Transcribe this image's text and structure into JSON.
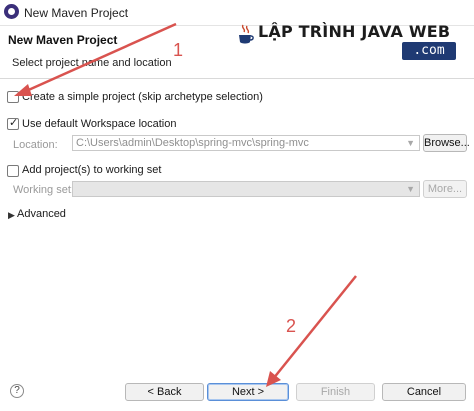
{
  "window": {
    "title": "New Maven Project"
  },
  "header": {
    "title": "New Maven Project",
    "subtitle": "Select project name and location"
  },
  "watermark": {
    "text": "LẬP TRÌNH JAVA WEB",
    "suffix": ".com"
  },
  "annotations": {
    "step1": "1",
    "step2": "2"
  },
  "options": {
    "simple_project": {
      "label": "Create a simple project (skip archetype selection)",
      "checked": false
    },
    "default_workspace": {
      "label": "Use default Workspace location",
      "checked": true
    },
    "location": {
      "label": "Location:",
      "value": "C:\\Users\\admin\\Desktop\\spring-mvc\\spring-mvc",
      "browse": "Browse..."
    },
    "working_set_check": {
      "label": "Add project(s) to working set",
      "checked": false
    },
    "working_set": {
      "label": "Working set:",
      "value": "",
      "more": "More..."
    },
    "advanced": {
      "label": "Advanced"
    }
  },
  "buttons": {
    "help": "?",
    "back": "< Back",
    "next": "Next >",
    "finish": "Finish",
    "cancel": "Cancel"
  },
  "colors": {
    "annotation": "#d9534f",
    "watermark_bg": "#1f3a73",
    "primary_button_border": "#5a8fd8"
  },
  "icons": [
    "eclipse-icon",
    "java-cup-icon",
    "chevron-down-icon",
    "triangle-right-icon",
    "help-icon"
  ]
}
